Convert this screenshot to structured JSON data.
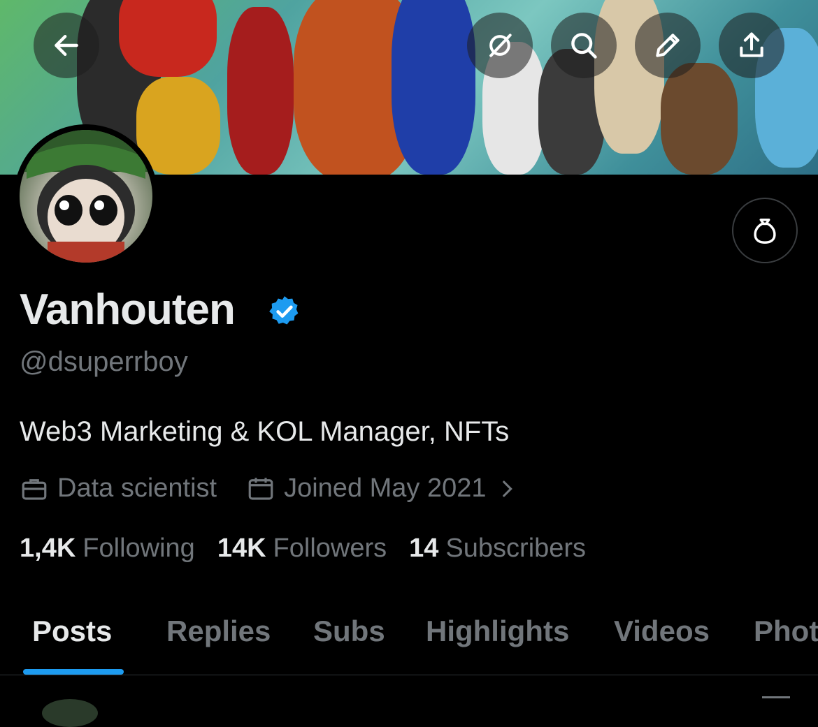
{
  "profile": {
    "name": "Vanhouten",
    "handle": "@dsuperrboy",
    "bio": "Web3 Marketing & KOL Manager, NFTs",
    "profession": "Data scientist",
    "joined": "Joined May 2021",
    "verified": true
  },
  "stats": {
    "following_count": "1,4K",
    "following_label": "Following",
    "followers_count": "14K",
    "followers_label": "Followers",
    "subscribers_count": "14",
    "subscribers_label": "Subscribers"
  },
  "tabs": [
    {
      "label": "Posts",
      "active": true
    },
    {
      "label": "Replies",
      "active": false
    },
    {
      "label": "Subs",
      "active": false
    },
    {
      "label": "Highlights",
      "active": false
    },
    {
      "label": "Videos",
      "active": false
    },
    {
      "label": "Phot",
      "active": false
    }
  ],
  "header_buttons": [
    "back-arrow-icon",
    "grok-icon",
    "search-icon",
    "pencil-icon",
    "share-icon"
  ],
  "colors": {
    "background": "#000000",
    "accent": "#1d9bf0",
    "text_primary": "#e7e9ea",
    "text_secondary": "#71767b"
  }
}
